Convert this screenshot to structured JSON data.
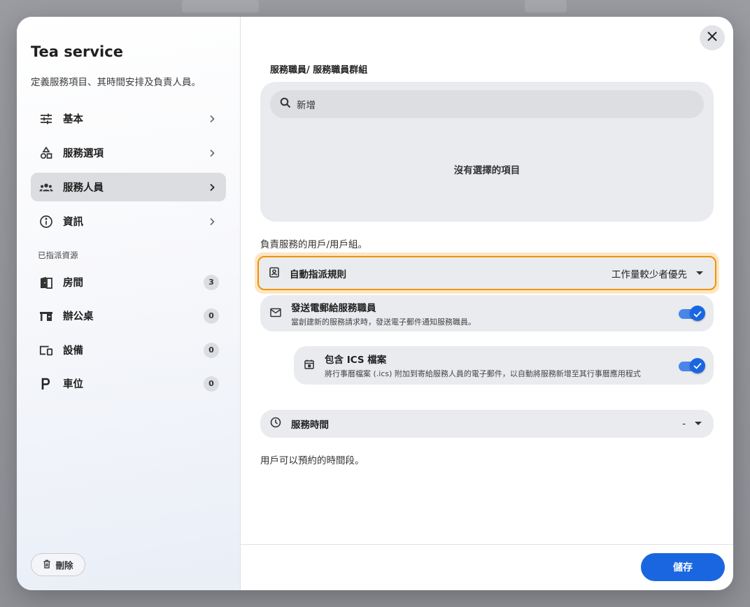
{
  "sidebar": {
    "title": "Tea service",
    "description": "定義服務項目、其時間安排及負責人員。",
    "nav": [
      {
        "label": "基本",
        "icon": "sliders-icon"
      },
      {
        "label": "服務選項",
        "icon": "shapes-icon"
      },
      {
        "label": "服務人員",
        "icon": "group-icon"
      },
      {
        "label": "資訊",
        "icon": "info-icon"
      }
    ],
    "resources_label": "已指派資源",
    "resources": [
      {
        "label": "房間",
        "count": "3",
        "icon": "room-icon"
      },
      {
        "label": "辦公桌",
        "count": "0",
        "icon": "desk-icon"
      },
      {
        "label": "設備",
        "count": "0",
        "icon": "devices-icon"
      },
      {
        "label": "車位",
        "count": "0",
        "icon": "parking-icon"
      }
    ],
    "delete_label": "刪除"
  },
  "main": {
    "staff_label": "服務職員/ 服務職員群組",
    "search_placeholder": "新增",
    "empty_text": "沒有選擇的項目",
    "staff_helper": "負責服務的用戶/用戶組。",
    "auto_assign": {
      "label": "自動指派規則",
      "value": "工作量較少者優先"
    },
    "email": {
      "title": "發送電郵給服務職員",
      "subtitle": "當創建新的服務請求時，發送電子郵件通知服務職員。",
      "enabled": true
    },
    "ics": {
      "title": "包含 ICS 檔案",
      "subtitle": "將行事曆檔案 (.ics) 附加到寄給服務人員的電子郵件，以自動將服務新增至其行事曆應用程式",
      "enabled": true
    },
    "service_time": {
      "label": "服務時間",
      "value": "-"
    },
    "time_helper": "用戶可以預約的時間段。"
  },
  "footer": {
    "save_label": "儲存"
  },
  "colors": {
    "accent": "#1a66e0",
    "highlight": "#f09400"
  }
}
